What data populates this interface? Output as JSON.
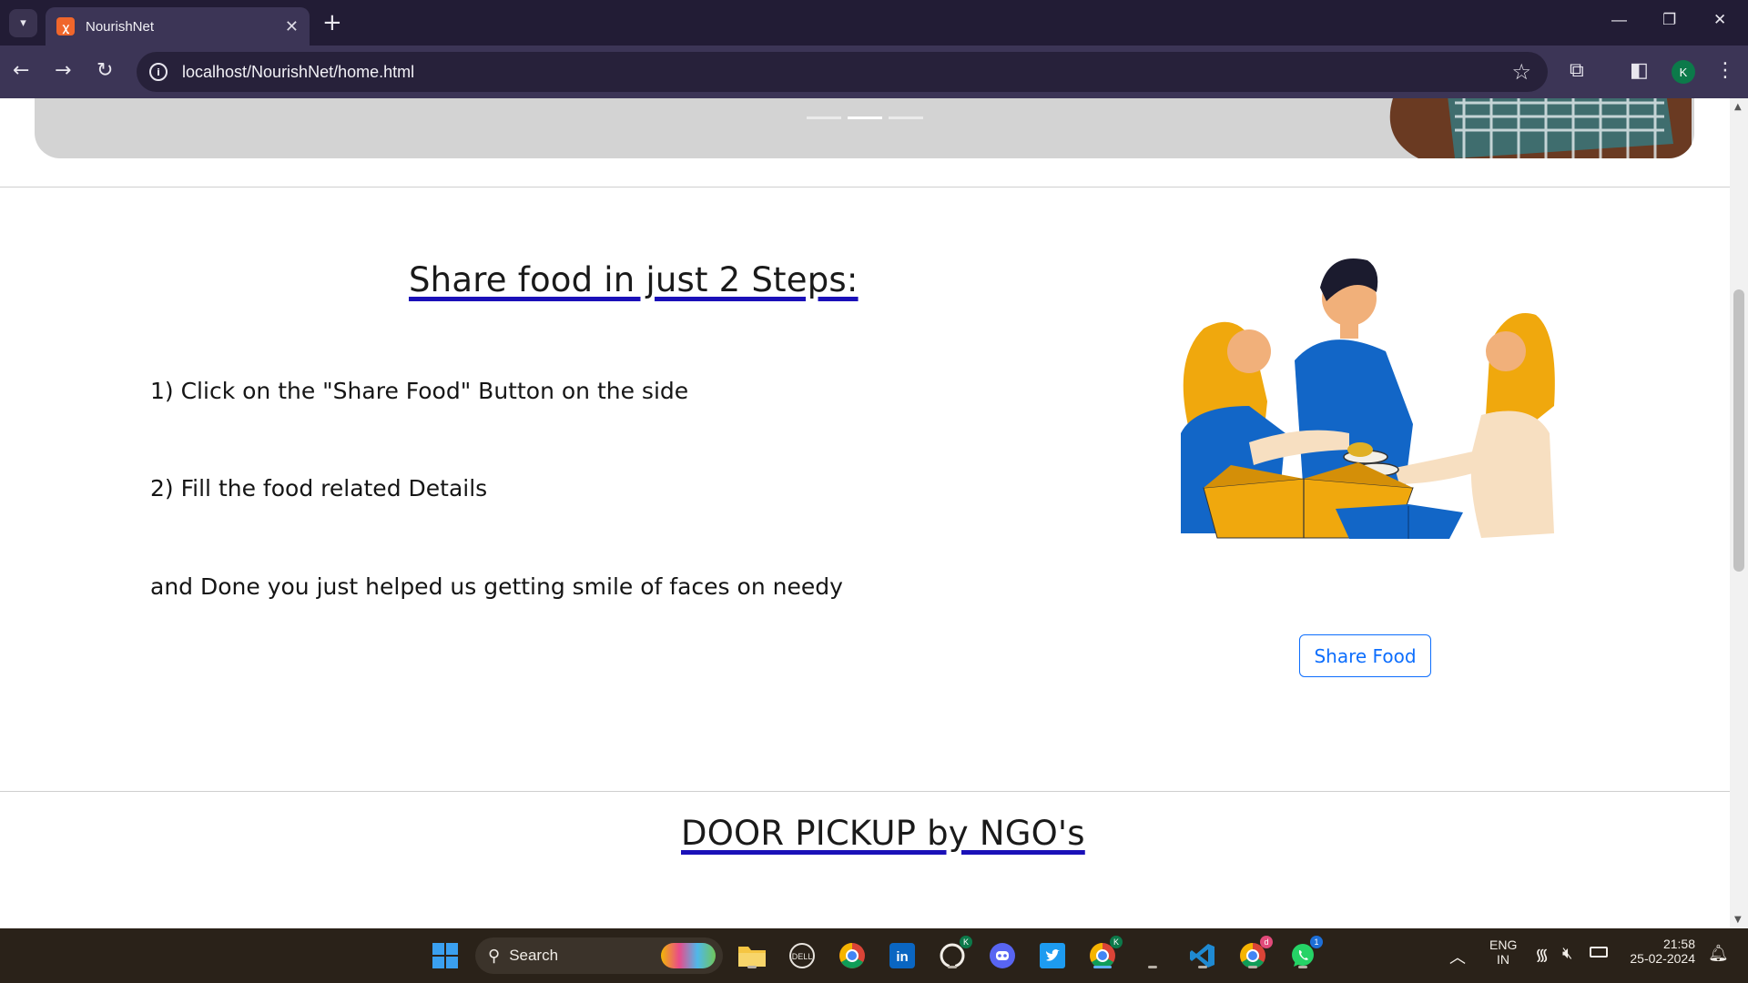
{
  "browser": {
    "tab_title": "NourishNet",
    "url": "localhost/NourishNet/home.html",
    "profile_initial": "K"
  },
  "page": {
    "carousel": {
      "indicator_count": 3,
      "active_indicator": 1
    },
    "steps_section": {
      "heading": "Share food in just 2 Steps:",
      "step1": "1) Click on the \"Share Food\" Button on the side",
      "step2": "2) Fill the food related Details",
      "closing": "and Done you just helped us getting smile of faces on needy",
      "share_button": "Share Food"
    },
    "pickup_section": {
      "heading": "DOOR PICKUP by NGO's"
    }
  },
  "taskbar": {
    "search_label": "Search",
    "language": "ENG",
    "region": "IN",
    "time": "21:58",
    "date": "25-02-2024",
    "badges": {
      "github_profile": "K",
      "chrome_profile": "K",
      "chrome_alt": "d",
      "whatsapp": "1"
    }
  },
  "colors": {
    "accent_blue": "#0d6efd",
    "heading_underline": "#1a10b8",
    "tabbar": "#221c35",
    "toolbar": "#3c3556"
  }
}
